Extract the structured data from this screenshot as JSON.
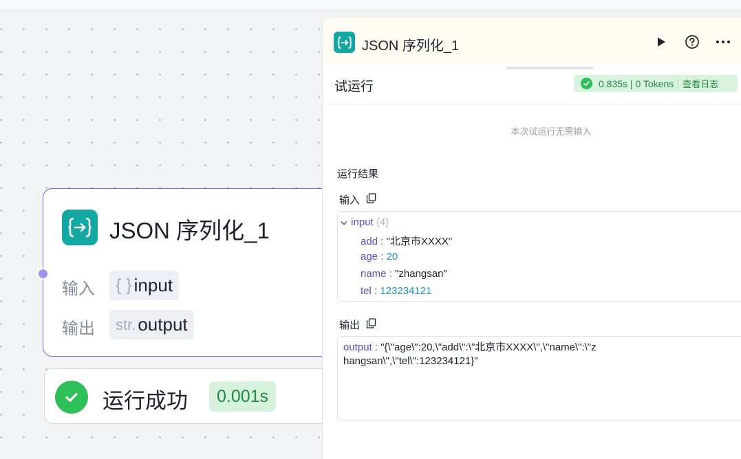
{
  "node": {
    "title": "JSON 序列化_1",
    "input_label": "输入",
    "input_type_icon": "{ }",
    "input_name": "input",
    "output_label": "输出",
    "output_type": "str.",
    "output_name": "output"
  },
  "status": {
    "text": "运行成功",
    "time": "0.001s"
  },
  "panel": {
    "title": "JSON 序列化_1",
    "drawer_title": "试运行",
    "metrics": "0.835s | 0 Tokens",
    "view_log": "查看日志",
    "no_input_text": "本次试运行无需输入",
    "results_title": "运行结果",
    "input_label": "输入",
    "output_label": "输出"
  },
  "input_tree": {
    "root_key": "input",
    "root_meta": "{4}",
    "fields": [
      {
        "key": "add",
        "value": "\"北京市XXXX\"",
        "type": "string"
      },
      {
        "key": "age",
        "value": "20",
        "type": "number"
      },
      {
        "key": "name",
        "value": "\"zhangsan\"",
        "type": "string"
      },
      {
        "key": "tel",
        "value": "123234121",
        "type": "number"
      }
    ]
  },
  "output_result": {
    "key": "output",
    "value": "\"{\\\"age\\\":20,\\\"add\\\":\\\"北京市XXXX\\\",\\\"name\\\":\\\"zhangsan\\\",\\\"tel\\\":123234121}\""
  },
  "icons": {
    "node": "json-serialize-icon",
    "run": "play-icon",
    "help": "help-circle-icon",
    "more": "more-icon",
    "copy": "copy-icon",
    "success": "check-circle-icon",
    "collapse": "chevron-down-icon"
  },
  "colors": {
    "node_icon_bg": "#13a8a1",
    "node_border": "#6b63e8",
    "success": "#2fbf59",
    "key": "#5b4ec9",
    "number": "#1896c8"
  }
}
